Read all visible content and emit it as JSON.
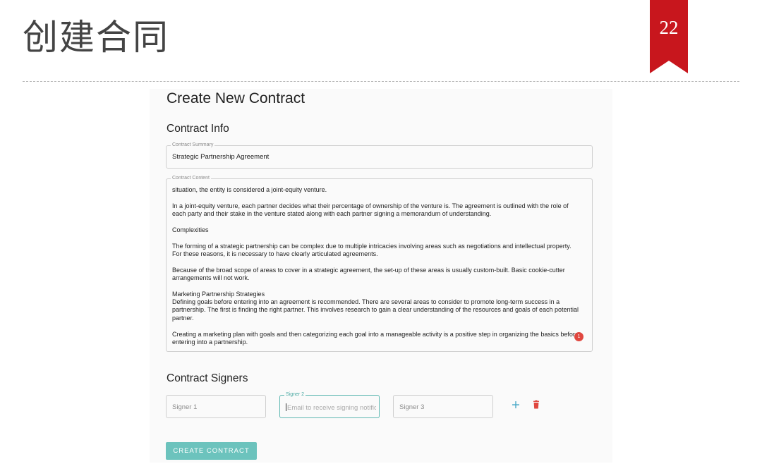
{
  "slide": {
    "title": "创建合同",
    "page_number": "22",
    "ribbon_color": "#c8161d"
  },
  "form": {
    "title": "Create New Contract",
    "contract_info": {
      "heading": "Contract Info",
      "summary_label": "Contract Summary",
      "summary_value": "Strategic Partnership Agreement",
      "content_label": "Contract Content",
      "content_paragraphs": [
        "situation, the entity is considered a joint-equity venture.",
        "In a joint-equity venture, each partner decides what their percentage of ownership of the venture is. The agreement is outlined with the role of each party and their stake in the venture stated along with each partner signing a memorandum of understanding.",
        "Complexities",
        "The forming of a strategic partnership can be complex due to multiple intricacies involving areas such as negotiations and intellectual property. For these reasons, it is necessary to have clearly articulated agreements.",
        "Because of the broad scope of areas to cover in a strategic agreement, the set-up of these areas is usually custom-built. Basic cookie-cutter arrangements will not work.",
        "Marketing Partnership Strategies\nDefining goals before entering into an agreement is recommended. There are several areas to consider to promote long-term success in a partnership. The first is finding the right partner. This involves research to gain a clear understanding of the resources and goals of each potential partner.",
        "Creating a marketing plan with goals and then categorizing each goal into a manageable activity is a positive step in organizing the basics before entering into a partnership."
      ],
      "badge_count": "1"
    },
    "signers": {
      "heading": "Contract Signers",
      "signer1_placeholder": "Signer 1",
      "signer2_label": "Signer 2",
      "signer2_placeholder": "Email to receive signing notification",
      "signer3_placeholder": "Signer 3",
      "add_icon": "plus-icon",
      "delete_icon": "trash-icon"
    },
    "submit_label": "CREATE CONTRACT",
    "accent_color": "#6cc3bd",
    "danger_color": "#e0473f"
  }
}
